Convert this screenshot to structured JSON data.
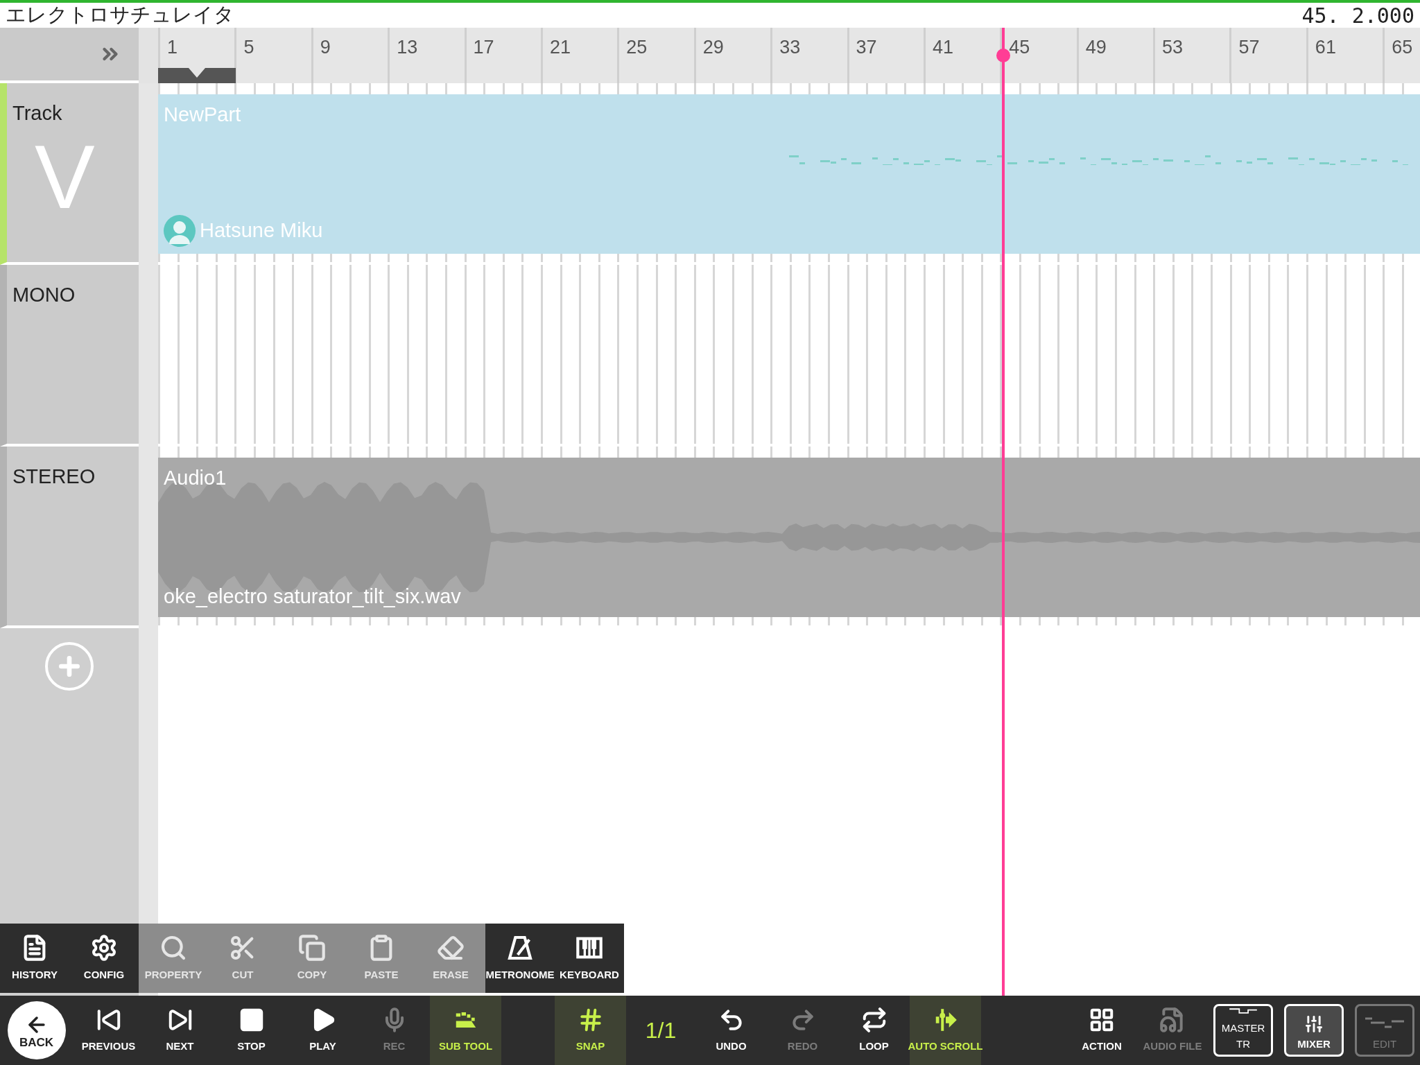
{
  "title": "エレクトロサチュレイタ",
  "position": "45. 2.000",
  "ruler": {
    "marks": [
      "1",
      "5",
      "9",
      "13",
      "17",
      "21",
      "25",
      "29",
      "33",
      "37",
      "41",
      "45",
      "49",
      "53",
      "57",
      "61",
      "65"
    ]
  },
  "tracks": [
    {
      "name": "Track",
      "badge": "V",
      "kind": "vocal",
      "selected": true,
      "part": {
        "name": "NewPart",
        "singer": "Hatsune Miku"
      }
    },
    {
      "name": "MONO",
      "kind": "mono",
      "selected": false
    },
    {
      "name": "STEREO",
      "kind": "stereo",
      "selected": false,
      "part": {
        "name": "Audio1",
        "file": "oke_electro saturator_tilt_six.wav"
      }
    }
  ],
  "toolbar": [
    {
      "label": "HISTORY",
      "disabled": false
    },
    {
      "label": "CONFIG",
      "disabled": false
    },
    {
      "label": "PROPERTY",
      "disabled": true
    },
    {
      "label": "CUT",
      "disabled": true
    },
    {
      "label": "COPY",
      "disabled": true
    },
    {
      "label": "PASTE",
      "disabled": true
    },
    {
      "label": "ERASE",
      "disabled": true
    },
    {
      "label": "METRONOME",
      "disabled": false
    },
    {
      "label": "KEYBOARD",
      "disabled": false
    }
  ],
  "transport": [
    {
      "label": "BACK",
      "kind": "back",
      "active": false,
      "disabled": false
    },
    {
      "label": "PREVIOUS",
      "kind": "button",
      "active": false,
      "disabled": false
    },
    {
      "label": "NEXT",
      "kind": "button",
      "active": false,
      "disabled": false
    },
    {
      "label": "STOP",
      "kind": "button",
      "active": false,
      "disabled": false
    },
    {
      "label": "PLAY",
      "kind": "button",
      "active": false,
      "disabled": false
    },
    {
      "label": "REC",
      "kind": "button",
      "active": false,
      "disabled": true
    },
    {
      "label": "SUB TOOL",
      "kind": "button",
      "active": true,
      "disabled": false
    }
  ],
  "edit_tools": [
    {
      "label": "SNAP",
      "kind": "button",
      "active": true,
      "disabled": false
    },
    {
      "label": "1/1",
      "kind": "value",
      "active": false,
      "disabled": false
    },
    {
      "label": "UNDO",
      "kind": "button",
      "active": false,
      "disabled": false
    },
    {
      "label": "REDO",
      "kind": "button",
      "active": false,
      "disabled": true
    },
    {
      "label": "LOOP",
      "kind": "button",
      "active": false,
      "disabled": false
    },
    {
      "label": "AUTO SCROLL",
      "kind": "button",
      "active": true,
      "disabled": false
    }
  ],
  "views": [
    {
      "label": "ACTION",
      "kind": "button",
      "selected": false,
      "disabled": false
    },
    {
      "label": "AUDIO FILE",
      "kind": "button",
      "selected": false,
      "disabled": true
    },
    {
      "label": "MASTER TR",
      "kind": "tab",
      "selected": false,
      "disabled": false
    },
    {
      "label": "MIXER",
      "kind": "tab",
      "selected": true,
      "disabled": false
    },
    {
      "label": "EDIT",
      "kind": "tab",
      "selected": false,
      "disabled": true
    }
  ]
}
